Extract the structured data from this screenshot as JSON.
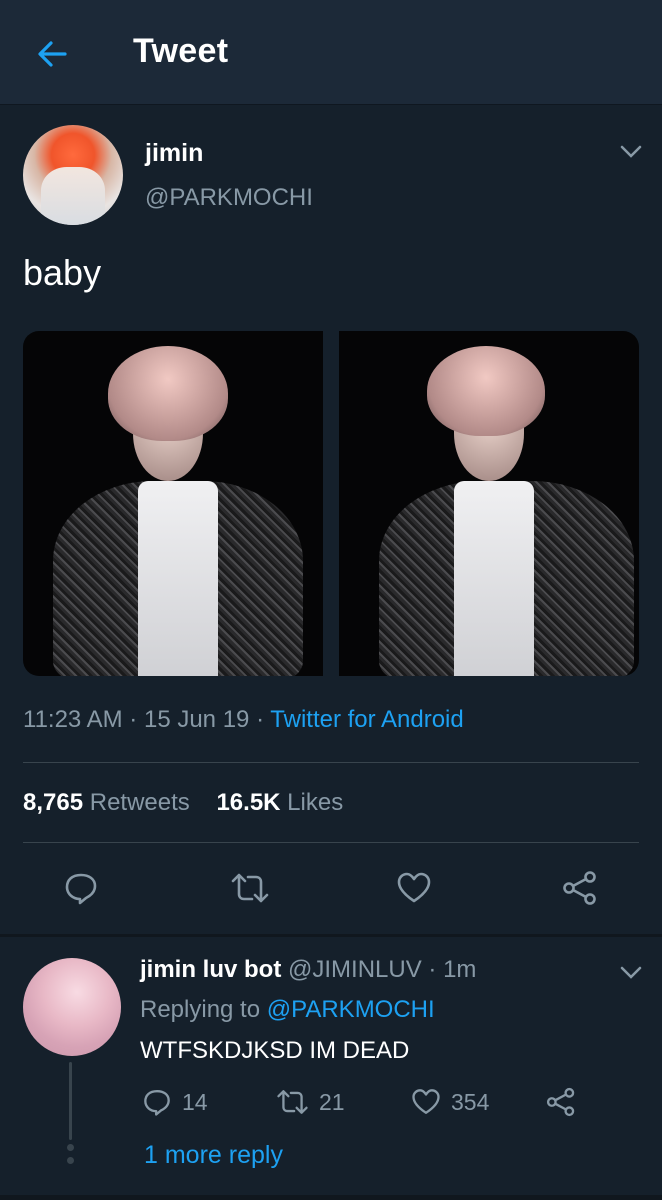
{
  "header": {
    "title": "Tweet",
    "back_icon": "arrow-left-icon",
    "accent": "#1da1f2"
  },
  "tweet": {
    "author_name": "jimin",
    "author_handle": "@PARKMOCHI",
    "text": "baby",
    "time": "11:23 AM",
    "date": "15 Jun 19",
    "source": "Twitter for Android",
    "retweets_count": "8,765",
    "retweets_label": "Retweets",
    "likes_count": "16.5K",
    "likes_label": "Likes",
    "media_count": 2
  },
  "actions": [
    "reply-icon",
    "retweet-icon",
    "like-icon",
    "share-icon"
  ],
  "reply": {
    "author_name": "jimin luv bot",
    "author_handle": "@JIMINLUV",
    "time": "1m",
    "replying_prefix": "Replying to",
    "replying_handle": "@PARKMOCHI",
    "text": "WTFSKDJKSD IM DEAD",
    "replies": "14",
    "retweets": "21",
    "likes": "354",
    "more_replies": "1 more reply"
  },
  "colors": {
    "background": "#15202b",
    "header": "#1c2938",
    "secondary_text": "#8899a6",
    "link": "#1da1f2",
    "divider": "#38444d"
  }
}
